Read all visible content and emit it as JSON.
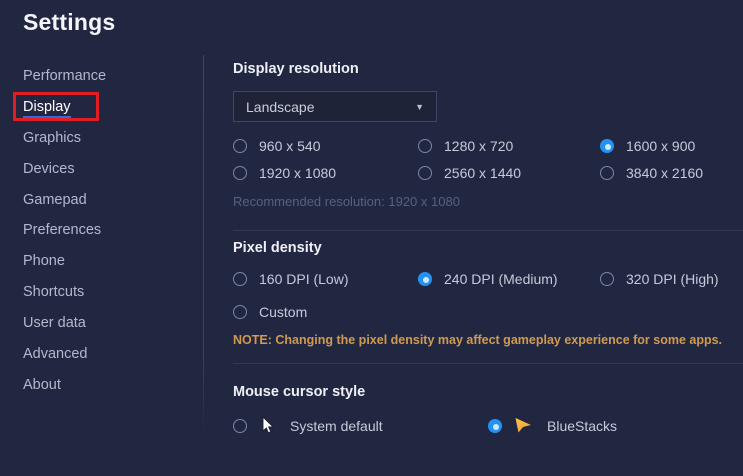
{
  "page": {
    "title": "Settings",
    "background_color": "#222741",
    "accent_blue": "#2492f5",
    "annotation_red": "#e01e23",
    "note_orange": "#d09a51"
  },
  "sidebar": {
    "items": [
      {
        "label": "Performance",
        "active": false
      },
      {
        "label": "Display",
        "active": true,
        "annotated": true
      },
      {
        "label": "Graphics",
        "active": false
      },
      {
        "label": "Devices",
        "active": false
      },
      {
        "label": "Gamepad",
        "active": false
      },
      {
        "label": "Preferences",
        "active": false
      },
      {
        "label": "Phone",
        "active": false
      },
      {
        "label": "Shortcuts",
        "active": false
      },
      {
        "label": "User data",
        "active": false
      },
      {
        "label": "Advanced",
        "active": false
      },
      {
        "label": "About",
        "active": false
      }
    ]
  },
  "display_resolution": {
    "heading": "Display resolution",
    "orientation_dropdown": {
      "value": "Landscape",
      "caret": "▼"
    },
    "options": [
      {
        "label": "960 x 540",
        "selected": false
      },
      {
        "label": "1280 x 720",
        "selected": false
      },
      {
        "label": "1600 x 900",
        "selected": true
      },
      {
        "label": "1920 x 1080",
        "selected": false
      },
      {
        "label": "2560 x 1440",
        "selected": false
      },
      {
        "label": "3840 x 2160",
        "selected": false
      }
    ],
    "recommended": "Recommended resolution: 1920 x 1080"
  },
  "pixel_density": {
    "heading": "Pixel density",
    "options": [
      {
        "label": "160 DPI (Low)",
        "selected": false
      },
      {
        "label": "240 DPI (Medium)",
        "selected": true
      },
      {
        "label": "320 DPI (High)",
        "selected": false
      },
      {
        "label": "Custom",
        "selected": false
      }
    ],
    "note": "NOTE: Changing the pixel density may affect gameplay experience for some apps."
  },
  "mouse_cursor": {
    "heading": "Mouse cursor style",
    "options": [
      {
        "label": "System default",
        "icon": "system-cursor-icon",
        "selected": false
      },
      {
        "label": "BlueStacks",
        "icon": "bluestacks-cursor-icon",
        "selected": true
      }
    ]
  }
}
